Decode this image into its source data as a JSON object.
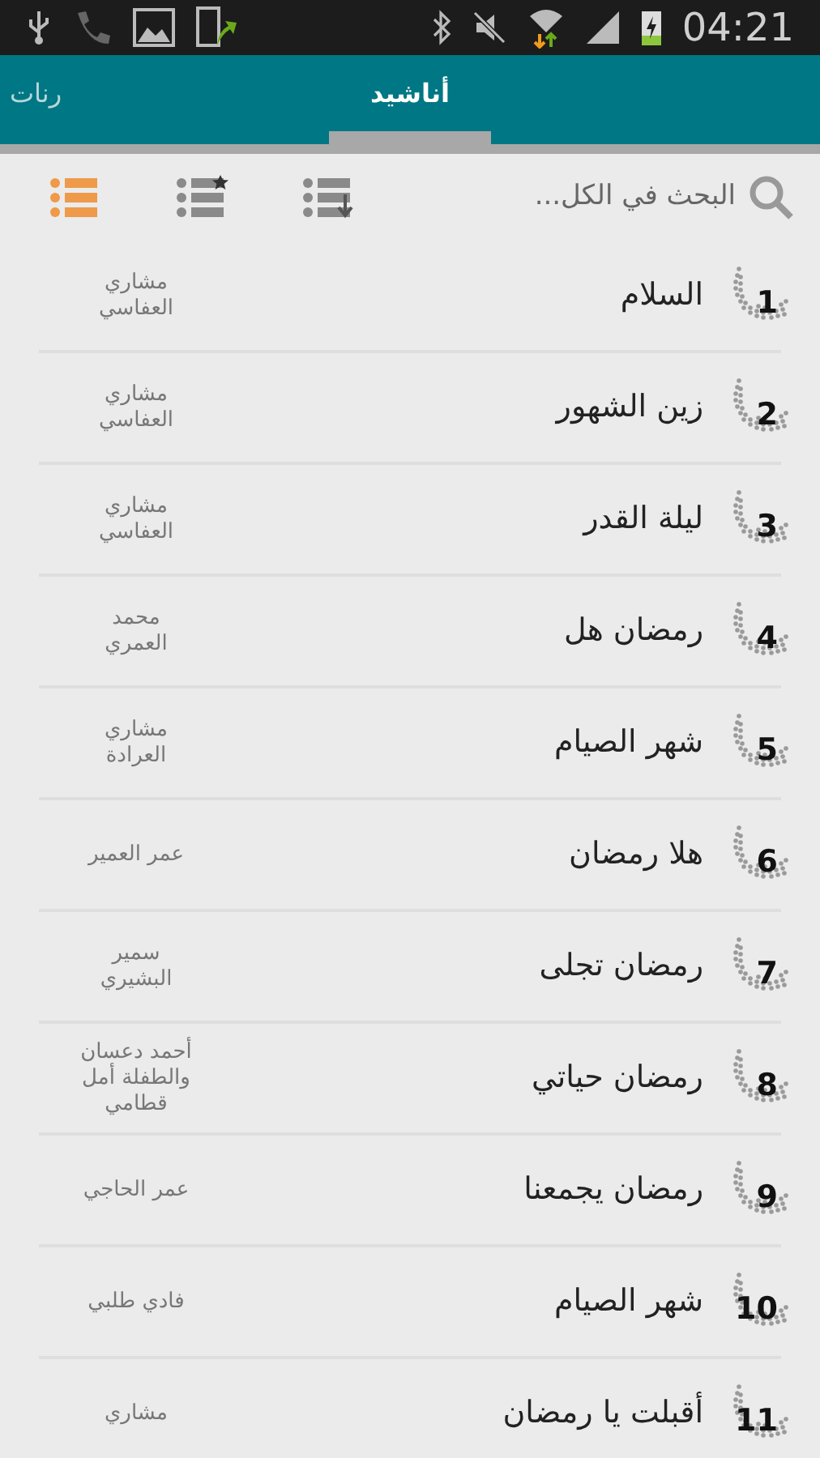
{
  "status_bar": {
    "time": "04:21"
  },
  "tabs": [
    {
      "label": "أناشيد",
      "selected": true
    },
    {
      "label": "رنات",
      "selected": false
    }
  ],
  "search": {
    "placeholder": "البحث في الكل..."
  },
  "view_buttons": [
    {
      "kind": "sorted",
      "selected": false
    },
    {
      "kind": "favorites",
      "selected": false
    },
    {
      "kind": "all",
      "selected": true
    }
  ],
  "songs": [
    {
      "number": "1",
      "title": "السلام",
      "artist": "مشاري العفاسي"
    },
    {
      "number": "2",
      "title": "زين الشهور",
      "artist": "مشاري العفاسي"
    },
    {
      "number": "3",
      "title": "ليلة القدر",
      "artist": "مشاري العفاسي"
    },
    {
      "number": "4",
      "title": "رمضان هل",
      "artist": "محمد العمري"
    },
    {
      "number": "5",
      "title": "شهر الصيام",
      "artist": "مشاري العرادة"
    },
    {
      "number": "6",
      "title": "هلا رمضان",
      "artist": "عمر العمير"
    },
    {
      "number": "7",
      "title": "رمضان تجلى",
      "artist": "سمير البشيري"
    },
    {
      "number": "8",
      "title": "رمضان حياتي",
      "artist": "أحمد دعسان والطفلة أمل قطامي"
    },
    {
      "number": "9",
      "title": "رمضان يجمعنا",
      "artist": "عمر الحاجي"
    },
    {
      "number": "10",
      "title": "شهر الصيام",
      "artist": "فادي طلبي"
    },
    {
      "number": "11",
      "title": "أقبلت يا رمضان",
      "artist": "مشاري"
    }
  ]
}
